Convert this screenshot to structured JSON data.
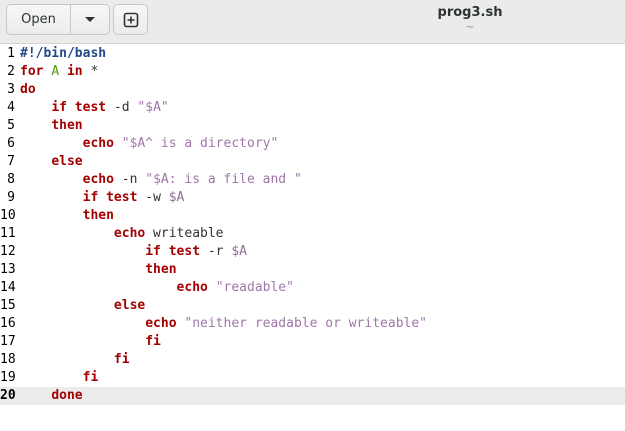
{
  "header": {
    "open_label": "Open",
    "title": "prog3.sh",
    "subtitle": "~"
  },
  "editor": {
    "current_line": 20,
    "lines": [
      {
        "num": "1",
        "indent": 0,
        "tokens": [
          {
            "t": "#!/bin/bash",
            "c": "shebang"
          }
        ]
      },
      {
        "num": "2",
        "indent": 0,
        "tokens": [
          {
            "t": "for",
            "c": "kw"
          },
          {
            "t": " ",
            "c": "plain"
          },
          {
            "t": "A",
            "c": "forvar"
          },
          {
            "t": " ",
            "c": "plain"
          },
          {
            "t": "in",
            "c": "kw"
          },
          {
            "t": " *",
            "c": "plain"
          }
        ]
      },
      {
        "num": "3",
        "indent": 0,
        "tokens": [
          {
            "t": "do",
            "c": "kw"
          }
        ]
      },
      {
        "num": "4",
        "indent": 4,
        "tokens": [
          {
            "t": "if",
            "c": "kw"
          },
          {
            "t": " ",
            "c": "plain"
          },
          {
            "t": "test",
            "c": "kw"
          },
          {
            "t": " -d ",
            "c": "plain"
          },
          {
            "t": "\"$A\"",
            "c": "str"
          }
        ]
      },
      {
        "num": "5",
        "indent": 4,
        "tokens": [
          {
            "t": "then",
            "c": "kw"
          }
        ]
      },
      {
        "num": "6",
        "indent": 8,
        "tokens": [
          {
            "t": "echo",
            "c": "kw"
          },
          {
            "t": " ",
            "c": "plain"
          },
          {
            "t": "\"$A^ is a directory\"",
            "c": "str"
          }
        ]
      },
      {
        "num": "7",
        "indent": 4,
        "tokens": [
          {
            "t": "else",
            "c": "kw"
          }
        ]
      },
      {
        "num": "8",
        "indent": 8,
        "tokens": [
          {
            "t": "echo",
            "c": "kw"
          },
          {
            "t": " -n ",
            "c": "plain"
          },
          {
            "t": "\"$A: is a file and \"",
            "c": "str"
          }
        ]
      },
      {
        "num": "9",
        "indent": 8,
        "tokens": [
          {
            "t": "if",
            "c": "kw"
          },
          {
            "t": " ",
            "c": "plain"
          },
          {
            "t": "test",
            "c": "kw"
          },
          {
            "t": " -w ",
            "c": "plain"
          },
          {
            "t": "$A",
            "c": "var"
          }
        ]
      },
      {
        "num": "10",
        "indent": 8,
        "tokens": [
          {
            "t": "then",
            "c": "kw"
          }
        ]
      },
      {
        "num": "11",
        "indent": 12,
        "tokens": [
          {
            "t": "echo",
            "c": "kw"
          },
          {
            "t": " writeable",
            "c": "plain"
          }
        ]
      },
      {
        "num": "12",
        "indent": 16,
        "tokens": [
          {
            "t": "if",
            "c": "kw"
          },
          {
            "t": " ",
            "c": "plain"
          },
          {
            "t": "test",
            "c": "kw"
          },
          {
            "t": " -r ",
            "c": "plain"
          },
          {
            "t": "$A",
            "c": "var"
          }
        ]
      },
      {
        "num": "13",
        "indent": 16,
        "tokens": [
          {
            "t": "then",
            "c": "kw"
          }
        ]
      },
      {
        "num": "14",
        "indent": 20,
        "tokens": [
          {
            "t": "echo",
            "c": "kw"
          },
          {
            "t": " ",
            "c": "plain"
          },
          {
            "t": "\"readable\"",
            "c": "str"
          }
        ]
      },
      {
        "num": "15",
        "indent": 12,
        "tokens": [
          {
            "t": "else",
            "c": "kw"
          }
        ]
      },
      {
        "num": "16",
        "indent": 16,
        "tokens": [
          {
            "t": "echo",
            "c": "kw"
          },
          {
            "t": " ",
            "c": "plain"
          },
          {
            "t": "\"neither readable or writeable\"",
            "c": "str"
          }
        ]
      },
      {
        "num": "17",
        "indent": 16,
        "tokens": [
          {
            "t": "fi",
            "c": "kw"
          }
        ]
      },
      {
        "num": "18",
        "indent": 12,
        "tokens": [
          {
            "t": "fi",
            "c": "kw"
          }
        ]
      },
      {
        "num": "19",
        "indent": 8,
        "tokens": [
          {
            "t": "fi",
            "c": "kw"
          }
        ]
      },
      {
        "num": "20",
        "indent": 4,
        "tokens": [
          {
            "t": "done",
            "c": "kw"
          }
        ]
      }
    ]
  },
  "colors": {
    "keyword": "#a40000",
    "string": "#a077a9",
    "shebang": "#204a87",
    "loop_variable": "#4e9a06",
    "current_line_bg": "#ececec"
  },
  "icons": {
    "dropdown": "chevron-down-icon",
    "new_tab": "new-tab-icon"
  }
}
